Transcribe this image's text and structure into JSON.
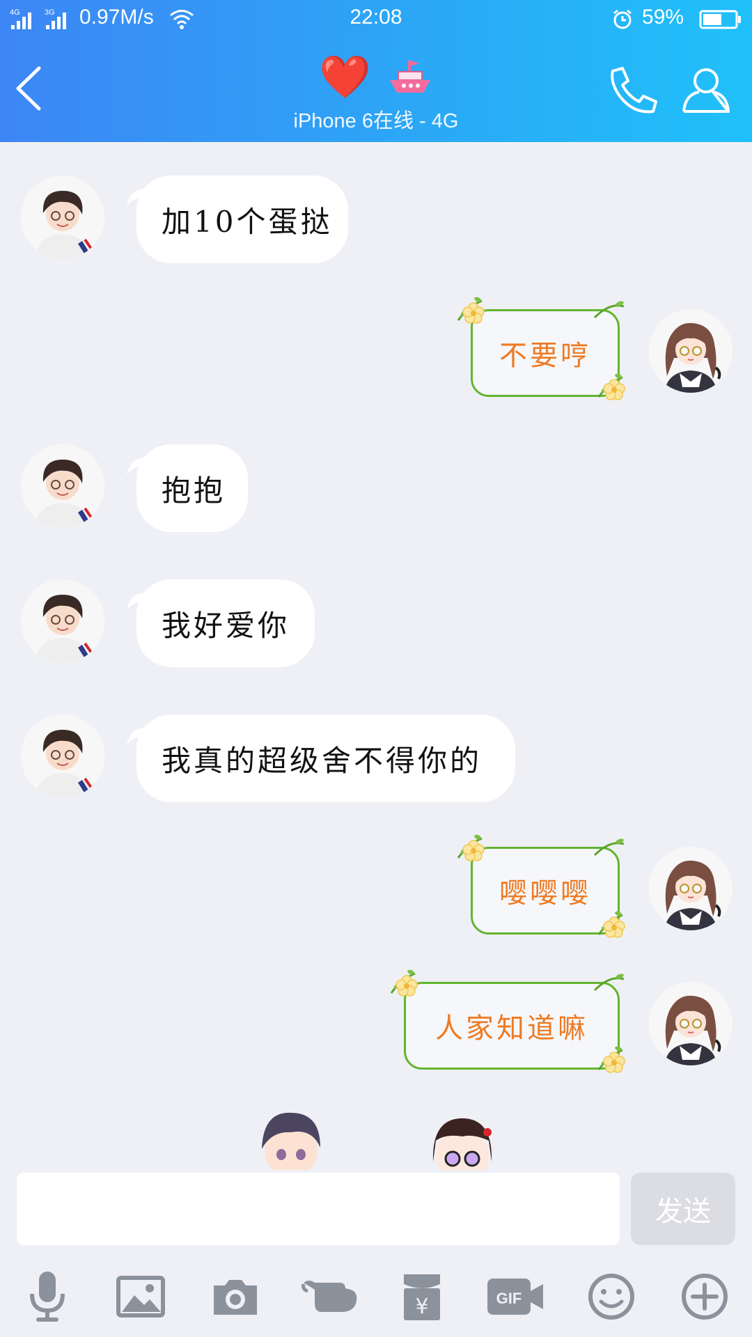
{
  "status_bar": {
    "network_left": "4G",
    "network_right": "3G",
    "speed": "0.97M/s",
    "time": "22:08",
    "battery_pct": "59%",
    "battery_level": 0.59
  },
  "header": {
    "title_emoji": "❤️",
    "subtitle": "iPhone 6在线 - 4G"
  },
  "messages": [
    {
      "from": "other",
      "text": "加10个蛋挞"
    },
    {
      "from": "me",
      "text": "不要哼"
    },
    {
      "from": "other",
      "text": "抱抱"
    },
    {
      "from": "other",
      "text": "我好爱你"
    },
    {
      "from": "other",
      "text": "我真的超级舍不得你的"
    },
    {
      "from": "me",
      "text": "嘤嘤嘤"
    },
    {
      "from": "me",
      "text": "人家知道嘛"
    }
  ],
  "input": {
    "value": "",
    "placeholder": "",
    "send_label": "发送"
  },
  "toolbar": [
    "microphone-icon",
    "image-icon",
    "camera-icon",
    "poke-icon",
    "red-packet-icon",
    "gif-icon",
    "emoji-icon",
    "plus-icon"
  ],
  "colors": {
    "header_start": "#3d86f5",
    "header_end": "#20c0fa",
    "flower_border": "#62b52e",
    "flower_text": "#ee7a22",
    "bg": "#eff0f6"
  }
}
